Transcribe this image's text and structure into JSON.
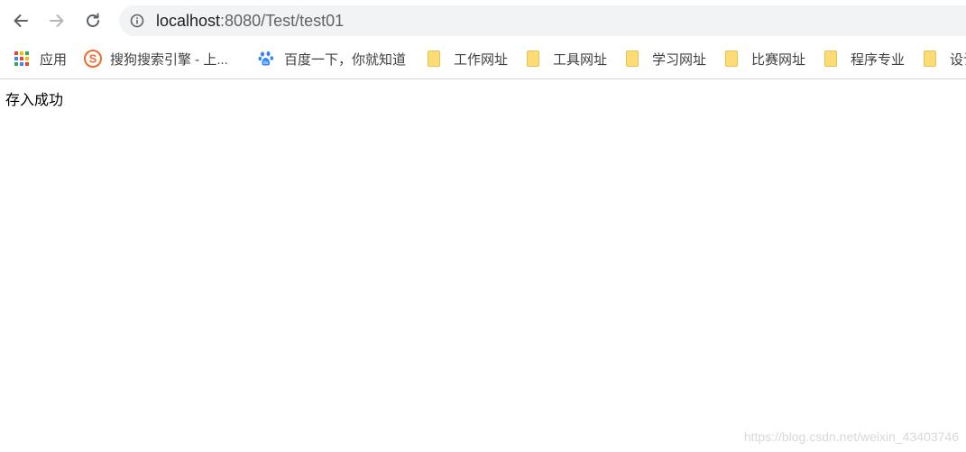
{
  "browser": {
    "url": {
      "host": "localhost",
      "path": ":8080/Test/test01"
    },
    "icons": {
      "back": "back-arrow-icon",
      "forward": "forward-arrow-icon",
      "reload": "reload-icon",
      "site_info": "info-icon"
    }
  },
  "bookmarks": [
    {
      "label": "应用",
      "icon": "apps-grid-icon"
    },
    {
      "label": "搜狗搜索引擎 - 上...",
      "icon": "sogou-icon"
    },
    {
      "label": "百度一下，你就知道",
      "icon": "baidu-paw-icon"
    },
    {
      "label": "工作网址",
      "icon": "folder-icon"
    },
    {
      "label": "工具网址",
      "icon": "folder-icon"
    },
    {
      "label": "学习网址",
      "icon": "folder-icon"
    },
    {
      "label": "比赛网址",
      "icon": "folder-icon"
    },
    {
      "label": "程序专业",
      "icon": "folder-icon"
    },
    {
      "label": "设计",
      "icon": "folder-icon"
    }
  ],
  "page": {
    "message": "存入成功"
  },
  "watermark": "https://blog.csdn.net/weixin_43403746",
  "colors": {
    "omnibox_bg": "#f1f3f4",
    "folder": "#fddc78",
    "sogou": "#f26b2a",
    "baidu": "#3385ff"
  }
}
